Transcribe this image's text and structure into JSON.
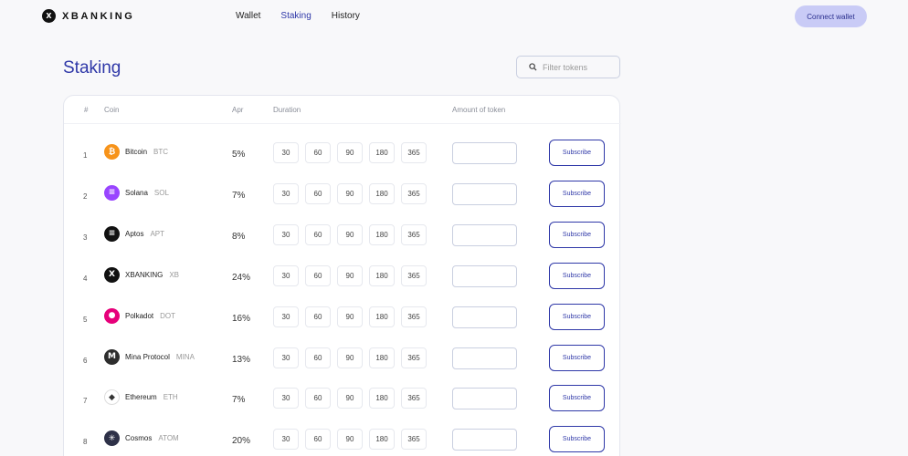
{
  "header": {
    "logo_text": "XBANKING",
    "nav": [
      {
        "label": "Wallet",
        "active": false
      },
      {
        "label": "Staking",
        "active": true
      },
      {
        "label": "History",
        "active": false
      }
    ],
    "connect_label": "Connect wallet"
  },
  "page": {
    "title": "Staking",
    "filter_placeholder": "Filter tokens"
  },
  "table": {
    "columns": {
      "num": "#",
      "coin": "Coin",
      "apr": "Apr",
      "duration": "Duration",
      "amount": "Amount of token"
    },
    "durations": [
      "30",
      "60",
      "90",
      "180",
      "365"
    ],
    "subscribe_label": "Subscribe",
    "rows": [
      {
        "num": "1",
        "name": "Bitcoin",
        "symbol": "BTC",
        "apr": "5%",
        "icon": "bitcoin-icon",
        "color": "#f7931a",
        "glyph": "₿"
      },
      {
        "num": "2",
        "name": "Solana",
        "symbol": "SOL",
        "apr": "7%",
        "icon": "solana-icon",
        "color": "#9945ff",
        "glyph": "≡"
      },
      {
        "num": "3",
        "name": "Aptos",
        "symbol": "APT",
        "apr": "8%",
        "icon": "aptos-icon",
        "color": "#111111",
        "glyph": "≡"
      },
      {
        "num": "4",
        "name": "XBANKING",
        "symbol": "XB",
        "apr": "24%",
        "icon": "xbanking-icon",
        "color": "#111111",
        "glyph": "X"
      },
      {
        "num": "5",
        "name": "Polkadot",
        "symbol": "DOT",
        "apr": "16%",
        "icon": "polkadot-icon",
        "color": "#e6007a",
        "glyph": "●"
      },
      {
        "num": "6",
        "name": "Mina Protocol",
        "symbol": "MINA",
        "apr": "13%",
        "icon": "mina-icon",
        "color": "#2d2d2d",
        "glyph": "M"
      },
      {
        "num": "7",
        "name": "Ethereum",
        "symbol": "ETH",
        "apr": "7%",
        "icon": "ethereum-icon",
        "color": "#ffffff",
        "glyph": "◆"
      },
      {
        "num": "8",
        "name": "Cosmos",
        "symbol": "ATOM",
        "apr": "20%",
        "icon": "cosmos-icon",
        "color": "#2e3148",
        "glyph": "✳"
      }
    ]
  },
  "colors": {
    "accent": "#2f38a8",
    "connect_bg": "#c9cbf6"
  }
}
